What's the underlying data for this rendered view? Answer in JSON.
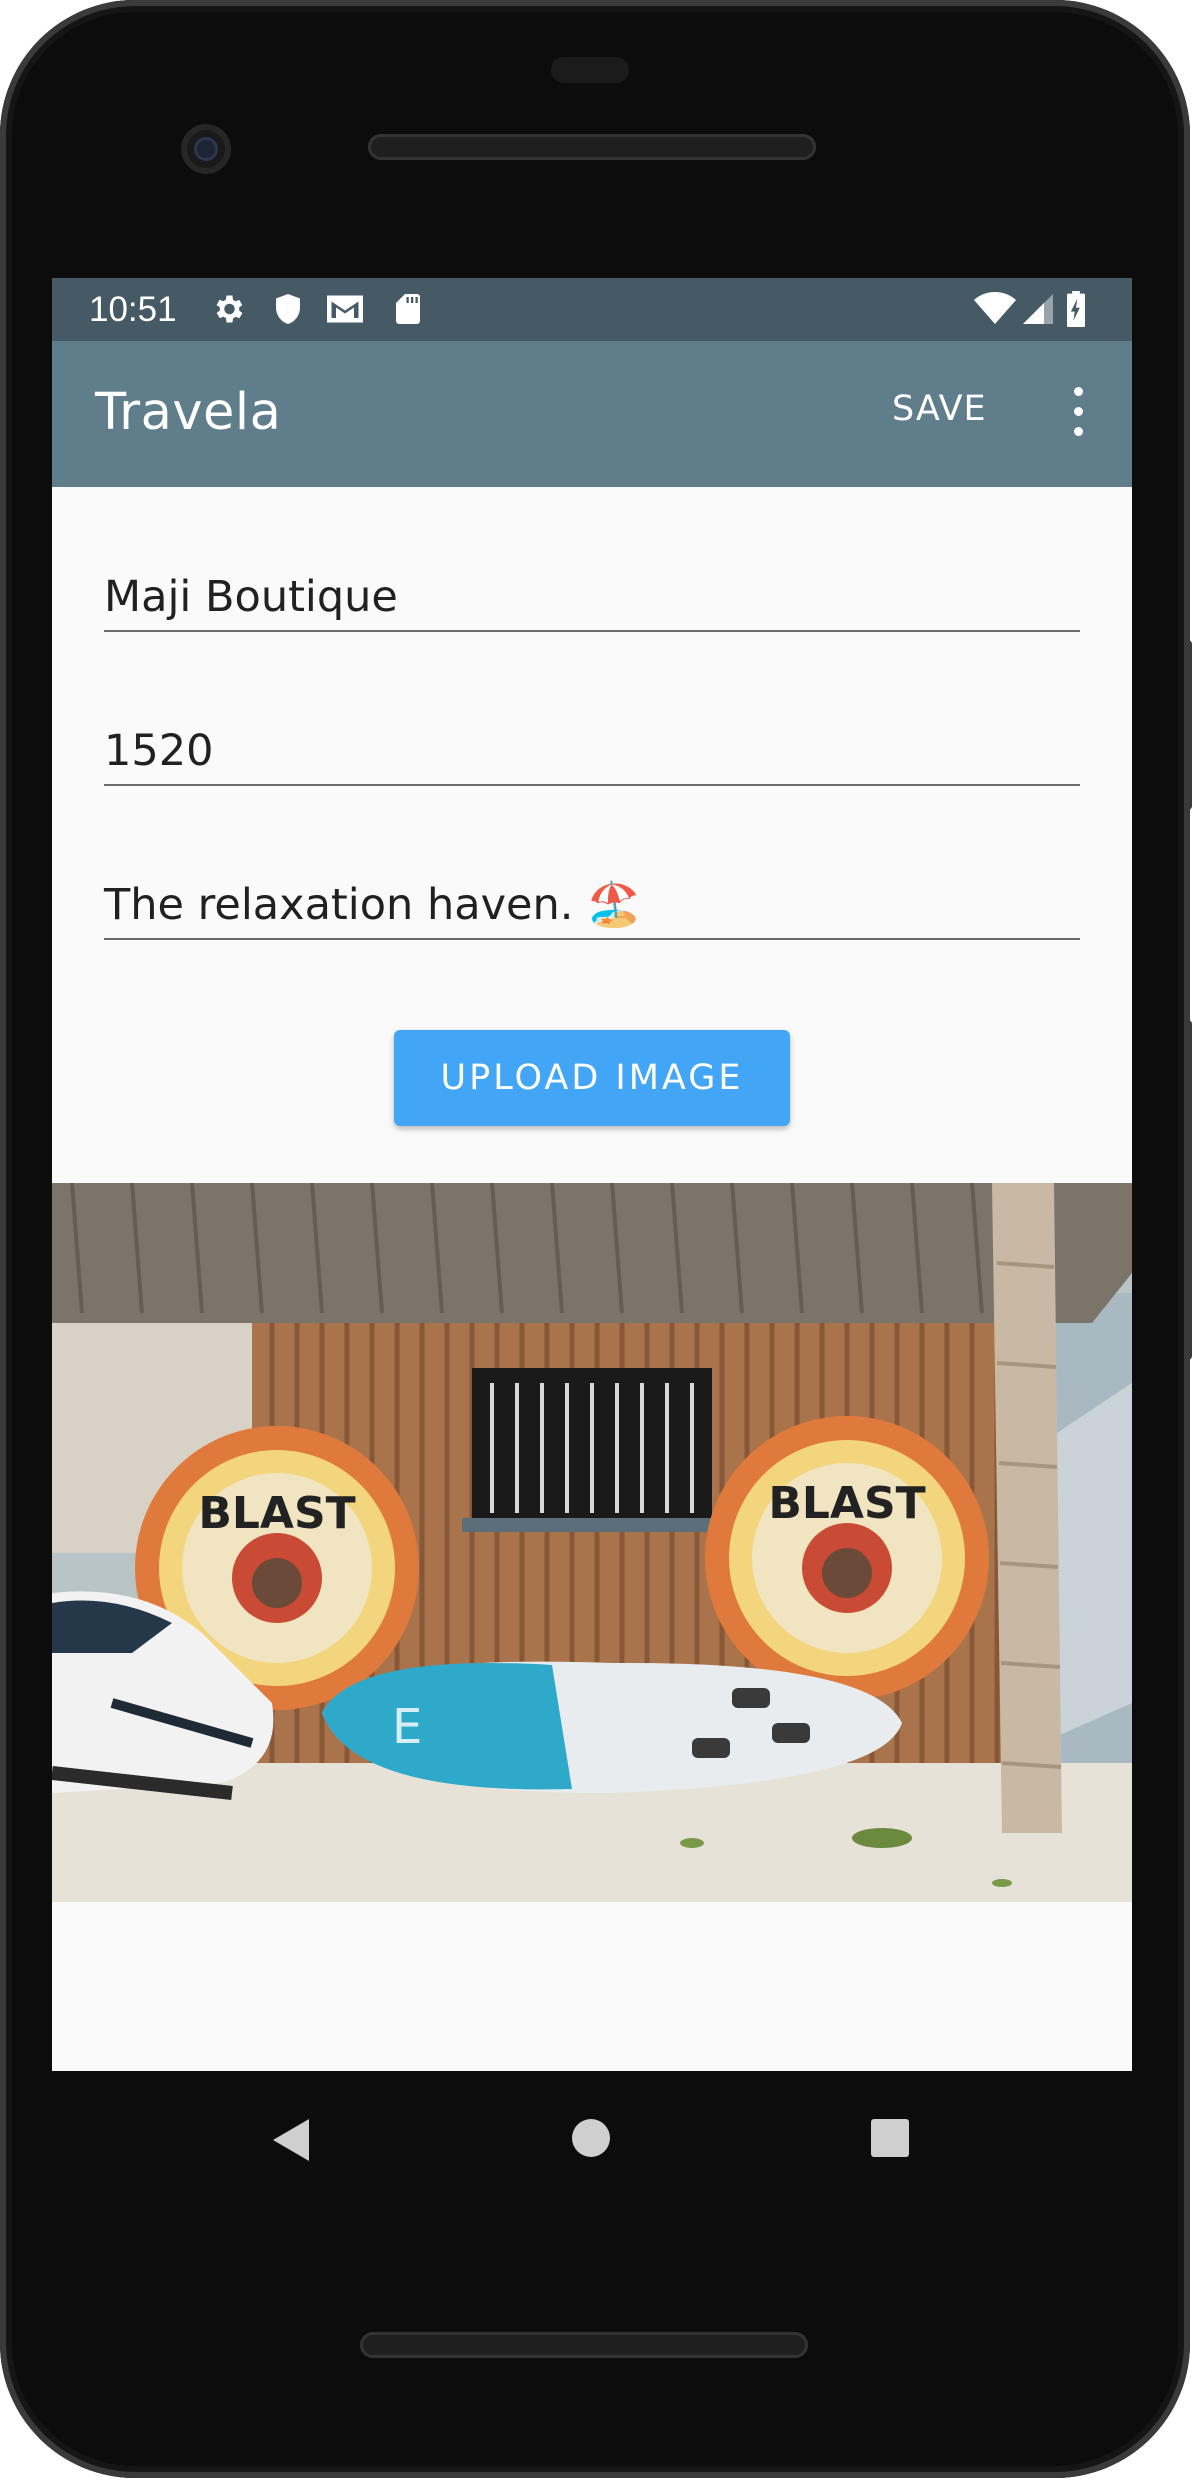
{
  "status_bar": {
    "time": "10:51",
    "left_icons": [
      "gear-icon",
      "shield-icon",
      "gmail-icon",
      "sd-card-icon"
    ],
    "right_icons": [
      "wifi-icon",
      "signal-icon",
      "battery-charging-icon"
    ]
  },
  "app_bar": {
    "title": "Travela",
    "save_label": "SAVE",
    "overflow_icon": "more-vert-icon"
  },
  "form": {
    "name_value": "Maji Boutique",
    "price_value": "1520",
    "description_value": "The relaxation haven. 🏖️"
  },
  "upload_button_label": "UPLOAD IMAGE",
  "photo": {
    "subject": "beach-hut-photo",
    "tube_text": "BLAST",
    "board_text": "E"
  },
  "nav": {
    "back_icon": "back-triangle-icon",
    "home_icon": "home-circle-icon",
    "recents_icon": "recents-square-icon"
  },
  "colors": {
    "status_bar": "#455a64",
    "app_bar": "#607d8b",
    "accent_button": "#42a5f5",
    "background": "#fafafa"
  }
}
